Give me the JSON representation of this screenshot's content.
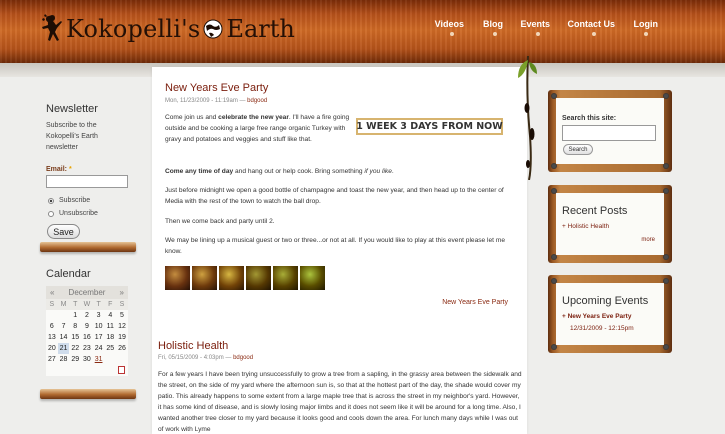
{
  "brand": {
    "name_part1": "Kokopelli's",
    "name_part2": "Earth"
  },
  "nav": [
    {
      "label": "Videos"
    },
    {
      "label": "Blog"
    },
    {
      "label": "Events"
    },
    {
      "label": "Contact Us"
    },
    {
      "label": "Login"
    }
  ],
  "newsletter": {
    "title": "Newsletter",
    "description": "Subscribe to the Kokopelli's Earth newsletter",
    "email_label": "Email:",
    "required_mark": "*",
    "email_value": "",
    "options": [
      {
        "label": "Subscribe",
        "selected": true
      },
      {
        "label": "Unsubscribe",
        "selected": false
      }
    ],
    "save_label": "Save"
  },
  "calendar": {
    "title": "Calendar",
    "prev": "«",
    "month": "December",
    "next": "»",
    "weekdays": [
      "S",
      "M",
      "T",
      "W",
      "T",
      "F",
      "S"
    ],
    "weeks": [
      [
        "",
        "",
        "1",
        "2",
        "3",
        "4",
        "5"
      ],
      [
        "6",
        "7",
        "8",
        "9",
        "10",
        "11",
        "12"
      ],
      [
        "13",
        "14",
        "15",
        "16",
        "17",
        "18",
        "19"
      ],
      [
        "20",
        "21",
        "22",
        "23",
        "24",
        "25",
        "26"
      ],
      [
        "27",
        "28",
        "29",
        "30",
        "31",
        "",
        ""
      ]
    ],
    "today": "21",
    "linked_days": [
      "31"
    ]
  },
  "posts": [
    {
      "title": "New Years Eve Party",
      "date": "Mon, 11/23/2009 - 11:19am",
      "separator": " — ",
      "author": "bdgood",
      "p1_a": "Come join us and ",
      "p1_b": "celebrate the new year",
      "p1_c": ".  I'll have a fire going outside and be cooking a large free range organic Turkey with gravy and potatoes and veggies and stuff like that.",
      "promo": "1 WEEK 3 DAYS FROM NOW",
      "p2_a": "Come any time of day",
      "p2_b": " and hang out or help cook.  Bring something ",
      "p2_c": "if you like",
      "p2_d": ".",
      "p3": "Just before midnight we open a good bottle of champagne and toast the new year, and then head up to the center of Media with the rest of the town to watch the ball drop.",
      "p4": "Then we come back and party until 2.",
      "p5": "We may be lining up a musical guest or two or three...or not at all.  If you would like to play at this event please let me know.",
      "thumb_count": 6,
      "tag": "New Years Eve Party"
    },
    {
      "title": "Holistic Health",
      "date": "Fri, 05/15/2009 - 4:03pm",
      "separator": " — ",
      "author": "bdgood",
      "p1": "For a few years I have been trying unsuccessfully to grow a tree from a sapling, in the grassy area between the sidewalk and the street, on the side of my yard where the afternoon sun is, so that at the hottest part of the day, the shade would cover my patio. This already happens to some extent from a large maple tree that is across the street in my neighbor's yard. However, it has some kind of disease, and is slowly losing major limbs and it does not seem like it will be around for a long time. Also, I wanted another tree closer to my yard because it looks good and cools down the area. For lunch many days while I was out of work with Lyme"
    }
  ],
  "search": {
    "title": "Search this site:",
    "value": "",
    "button_label": "Search"
  },
  "recent_posts": {
    "title": "Recent Posts",
    "items": [
      "Holistic Health"
    ],
    "more": "more"
  },
  "upcoming_events": {
    "title": "Upcoming Events",
    "items": [
      {
        "name": "New Years Eve Party",
        "date": "12/31/2009 - 12:15pm"
      }
    ]
  },
  "colors": {
    "header": "#b5501a",
    "link": "#7a1d0c",
    "wood": "#a86a30",
    "promo_border": "#d7b46f"
  }
}
